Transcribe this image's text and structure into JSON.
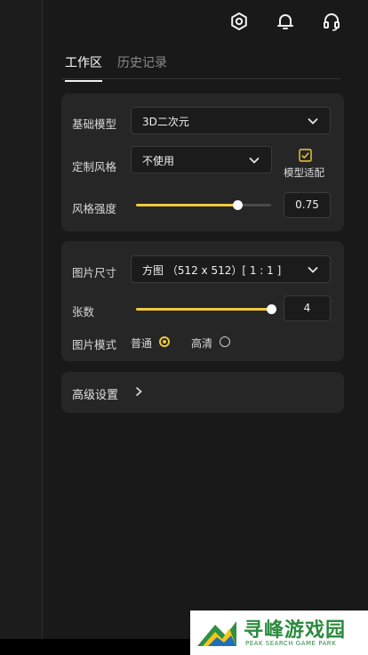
{
  "colors": {
    "accent": "#f0c93e",
    "panel": "#262626",
    "background": "#191919"
  },
  "header": {
    "icons": [
      "gear-icon",
      "bell-icon",
      "headset-icon"
    ]
  },
  "tabs": [
    {
      "label": "工作区",
      "active": true
    },
    {
      "label": "历史记录",
      "active": false
    }
  ],
  "model_card": {
    "base_model_label": "基础模型",
    "base_model_value": "3D二次元",
    "style_label": "定制风格",
    "style_value": "不使用",
    "model_adapt_label": "模型适配",
    "model_adapt_checked": true,
    "strength_label": "风格强度",
    "strength_value": "0.75",
    "strength_fraction": 0.75
  },
  "image_card": {
    "size_label": "图片尺寸",
    "size_value": "方图 （512 x 512）[ 1 : 1 ]",
    "count_label": "张数",
    "count_value": "4",
    "count_fraction": 1.0,
    "mode_label": "图片模式",
    "mode_options": [
      {
        "label": "普通",
        "selected": true
      },
      {
        "label": "高清",
        "selected": false
      }
    ]
  },
  "advanced": {
    "label": "高级设置"
  },
  "watermark": {
    "cn": "寻峰游戏园",
    "en": "PEAK SEARCH GAME PARK"
  }
}
